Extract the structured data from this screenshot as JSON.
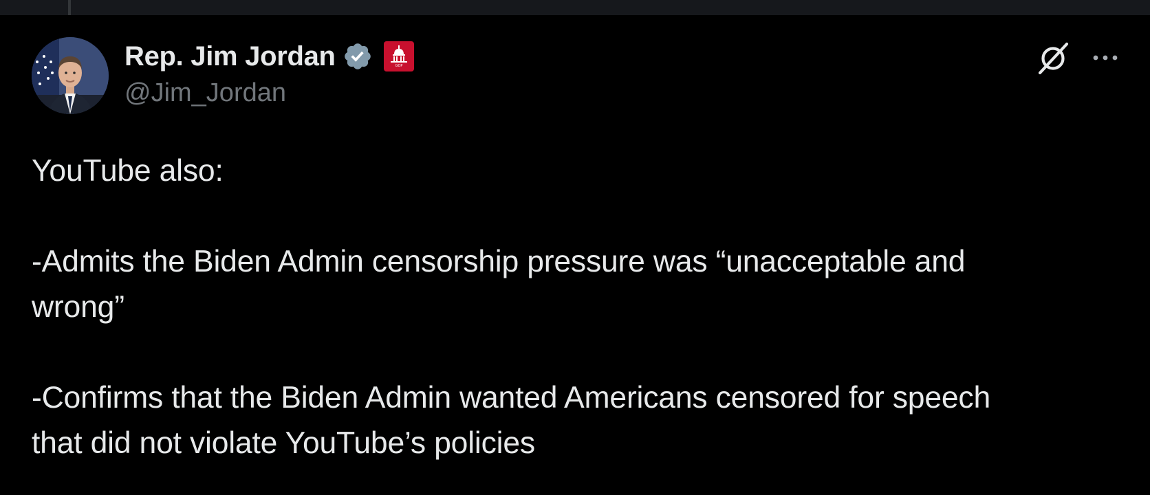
{
  "thread": {
    "has_parent_line": true
  },
  "tweet": {
    "author": {
      "display_name": "Rep. Jim Jordan",
      "handle": "@Jim_Jordan",
      "avatar_icon": "avatar-portrait",
      "verified_badge_icon": "verified-check-icon",
      "verified_badge_color": "#829aab",
      "affiliation_badge_icon": "capitol-dome-icon",
      "affiliation_badge_color": "#c8102e"
    },
    "actions": {
      "grok_icon": "grok-icon",
      "more_icon": "more-horizontal-icon"
    },
    "text": {
      "line_intro": "YouTube also:",
      "point_1": "-Admits the Biden Admin censorship pressure was “unacceptable and\nwrong”",
      "point_2": "-Confirms that the Biden Admin wanted Americans censored for speech\nthat did not violate YouTube’s policies"
    }
  },
  "colors": {
    "background": "#000000",
    "top_strip": "#16181c",
    "primary_text": "#e7e9ea",
    "secondary_text": "#71767b",
    "thread_line": "#333639"
  }
}
